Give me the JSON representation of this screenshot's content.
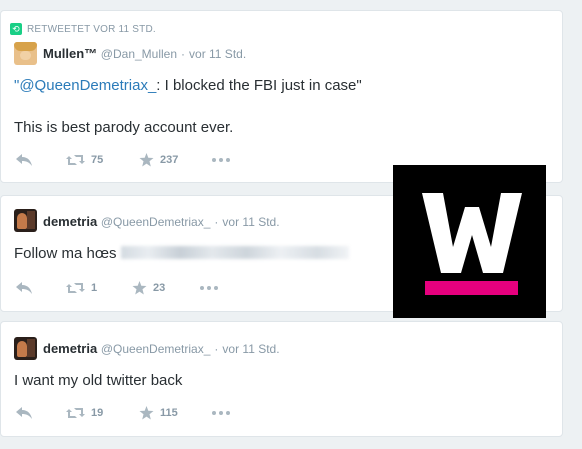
{
  "tweets": [
    {
      "retweet_label": "RETWEETET VOR 11 STD.",
      "name": "Mullen™",
      "handle": "@Dan_Mullen",
      "time": "vor 11 Std.",
      "quote_open": "\"",
      "mention": "@QueenDemetriax_",
      "text_after_mention": ": I blocked the FBI just in case\"",
      "line2": "This is best parody account ever.",
      "retweets": "75",
      "favorites": "237"
    },
    {
      "name": "demetria",
      "handle": "@QueenDemetriax_",
      "time": "vor 11 Std.",
      "text": "Follow ma hœs",
      "retweets": "1",
      "favorites": "23"
    },
    {
      "name": "demetria",
      "handle": "@QueenDemetriax_",
      "time": "vor 11 Std.",
      "text": "I want my old twitter back",
      "retweets": "19",
      "favorites": "115"
    }
  ],
  "separator": "·",
  "icons": {
    "retweet_banner": "retweet-icon",
    "reply": "reply-icon",
    "retweet": "retweet-icon",
    "favorite": "star-icon",
    "more": "more-icon"
  },
  "colors": {
    "mention": "#2b7bb9",
    "retweet_green": "#19cf86",
    "logo_bg": "#000000",
    "logo_bar": "#e6007e",
    "action_gray": "#9aa7b0"
  }
}
